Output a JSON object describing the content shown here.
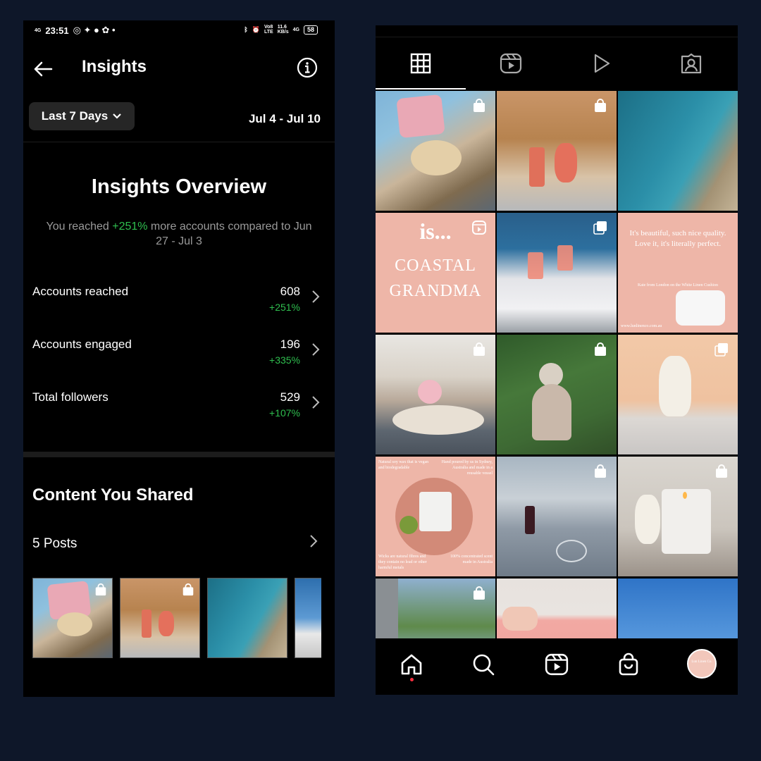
{
  "status": {
    "time": "23:51",
    "left_net": "4G",
    "speed": "11.6",
    "speed_unit": "KB/s",
    "right_net": "4G",
    "volte": "Vo8",
    "lte": "LTE",
    "battery": "58"
  },
  "insights": {
    "title": "Insights",
    "range_button": "Last 7 Days",
    "date_range": "Jul 4 - Jul 10",
    "overview_title": "Insights Overview",
    "overview_prefix": "You reached ",
    "overview_pct": "+251%",
    "overview_suffix": " more accounts compared to Jun 27 - Jul 3",
    "metrics": [
      {
        "label": "Accounts reached",
        "value": "608",
        "change": "+251%"
      },
      {
        "label": "Accounts engaged",
        "value": "196",
        "change": "+335%"
      },
      {
        "label": "Total followers",
        "value": "529",
        "change": "+107%"
      }
    ],
    "content_title": "Content You Shared",
    "posts_label": "5 Posts"
  },
  "profile": {
    "tabs": [
      "grid-icon",
      "reels-icon",
      "play-icon",
      "tagged-icon"
    ],
    "post_texts": {
      "p4_line1": "is...",
      "p4_line2": "COASTAL",
      "p4_line3": "GRANDMA",
      "p6_quote": "It's beautiful, such nice quality. Love it, it's literally perfect.",
      "p6_attr": "Kate from London on the White Linen Cushion",
      "p6_url": "www.lunlinenco.com.au",
      "p10_tl": "Natural soy wax that is vegan and biodegradable",
      "p10_tr": "Hand poured by us in Sydney, Australia and made in a reusable vessel",
      "p10_bl": "Wicks are natural fibres and they contain no lead or other harmful metals",
      "p10_br": "100% concentrated scent made in Australia"
    },
    "avatar_text": "Lun Linen Co."
  },
  "colors": {
    "accent_green": "#2fbf4f",
    "background": "#0e1729",
    "notif_dot": "#ff3040"
  }
}
